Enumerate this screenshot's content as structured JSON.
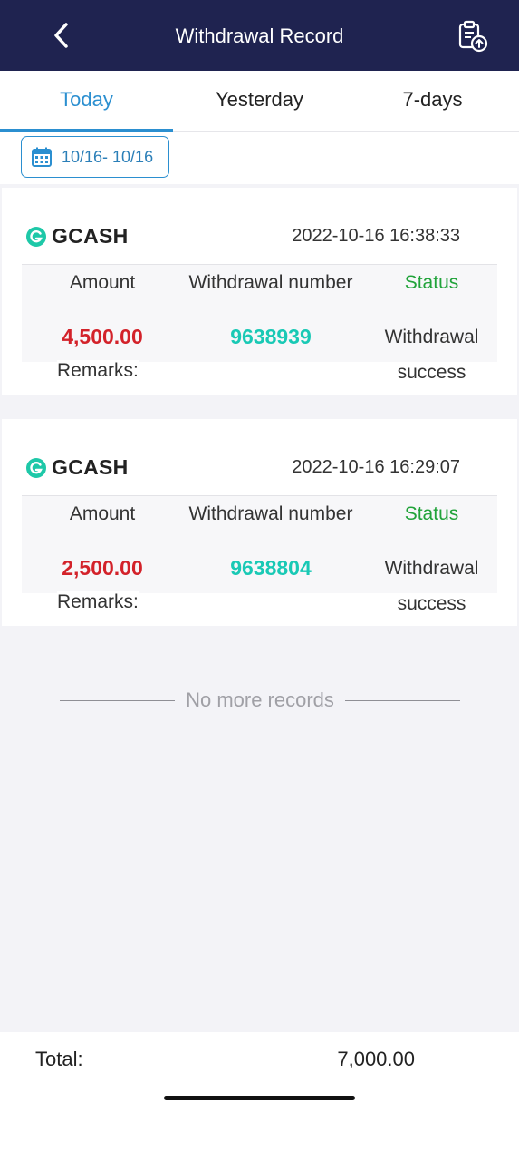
{
  "header": {
    "title": "Withdrawal Record",
    "back_icon": "chevron-left-icon",
    "export_icon": "clipboard-upload-icon"
  },
  "tabs": [
    {
      "label": "Today",
      "active": true
    },
    {
      "label": "Yesterday",
      "active": false
    },
    {
      "label": "7-days",
      "active": false
    }
  ],
  "date_filter": {
    "icon": "calendar-icon",
    "range": "10/16- 10/16"
  },
  "columns": {
    "amount": "Amount",
    "number": "Withdrawal number",
    "status": "Status",
    "remarks": "Remarks:"
  },
  "records": [
    {
      "method": "GCASH",
      "method_icon": "gcash-logo-icon",
      "datetime": "2022-10-16 16:38:33",
      "amount": "4,500.00",
      "number": "9638939",
      "status_line1": "Withdrawal",
      "status_line2": "success"
    },
    {
      "method": "GCASH",
      "method_icon": "gcash-logo-icon",
      "datetime": "2022-10-16 16:29:07",
      "amount": "2,500.00",
      "number": "9638804",
      "status_line1": "Withdrawal",
      "status_line2": "success"
    }
  ],
  "end_message": "No more records",
  "footer": {
    "total_label": "Total:",
    "total_value": "7,000.00"
  },
  "colors": {
    "header_bg": "#1f2350",
    "accent": "#2b8fd0",
    "amount": "#d3222a",
    "number": "#19c9b5",
    "status_header": "#21a33a",
    "gcash": "#1ec8a8"
  }
}
